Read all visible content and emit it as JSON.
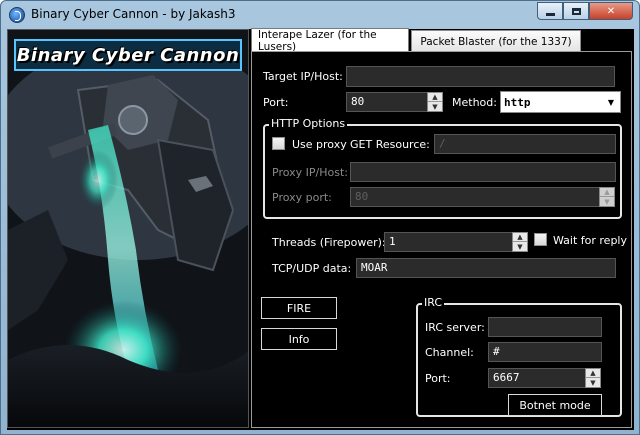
{
  "window": {
    "title": "Binary Cyber Cannon - by Jakash3"
  },
  "art": {
    "logo_text": "Binary Cyber Cannon"
  },
  "tabs": [
    {
      "label": "Interape Lazer (for the Lusers)",
      "active": true
    },
    {
      "label": "Packet Blaster (for the 1337)",
      "active": false
    }
  ],
  "form": {
    "target_label": "Target IP/Host:",
    "target_value": "",
    "port_label": "Port:",
    "port_value": "80",
    "method_label": "Method:",
    "method_value": "http",
    "http_options": {
      "title": "HTTP Options",
      "use_proxy_label": "Use proxy",
      "use_proxy_checked": false,
      "get_resource_label": "GET Resource:",
      "get_resource_value": "/",
      "proxy_host_label": "Proxy IP/Host:",
      "proxy_host_value": "",
      "proxy_port_label": "Proxy port:",
      "proxy_port_value": "80"
    },
    "threads_label": "Threads (Firepower):",
    "threads_value": "1",
    "wait_reply_label": "Wait for reply",
    "wait_reply_checked": false,
    "data_label": "TCP/UDP data:",
    "data_value": "MOAR",
    "fire_button": "FIRE",
    "info_button": "Info",
    "irc": {
      "title": "IRC",
      "server_label": "IRC server:",
      "server_value": "",
      "channel_label": "Channel:",
      "channel_value": "#",
      "port_label": "Port:",
      "port_value": "6667",
      "botnet_button": "Botnet mode"
    }
  },
  "colors": {
    "background": "#000000",
    "text": "#ffffff",
    "field": "#2b2b2b",
    "logo_border": "#57c6ff",
    "beam": "#3ee7c8"
  },
  "icons": {
    "app": "app-globe-icon",
    "minimize": "minimize-icon",
    "maximize": "maximize-icon",
    "close": "close-icon"
  }
}
